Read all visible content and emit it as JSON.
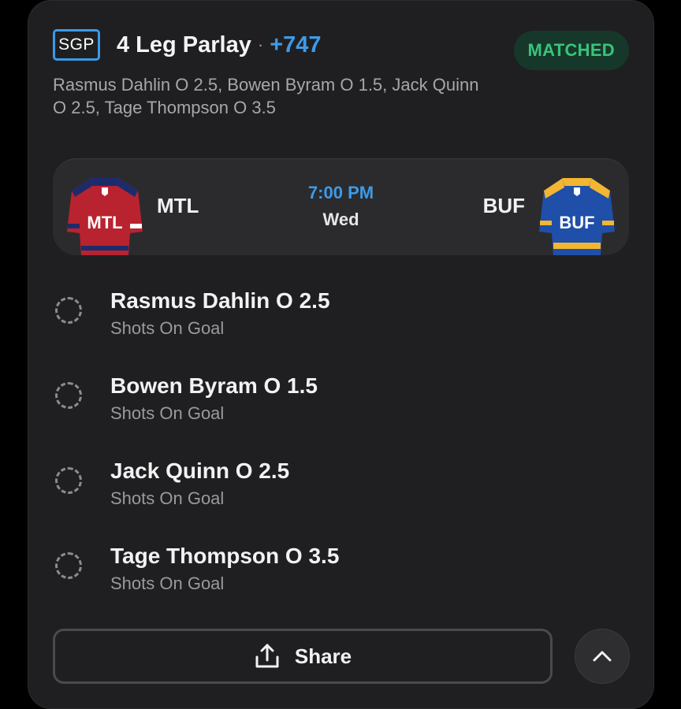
{
  "bet": {
    "badge": "SGP",
    "title": "4 Leg Parlay",
    "separator": "·",
    "odds": "+747",
    "status": "MATCHED",
    "summary": "Rasmus Dahlin O 2.5, Bowen Byram O 1.5, Jack Quinn O 2.5, Tage Thompson O 3.5"
  },
  "game": {
    "home": {
      "abbr": "MTL",
      "jersey_text": "MTL",
      "jersey_icon": "canadiens-jersey",
      "primary": "#b8232f",
      "secondary": "#1e2b6b"
    },
    "away": {
      "abbr": "BUF",
      "jersey_text": "BUF",
      "jersey_icon": "sabres-jersey",
      "primary": "#1f4fa8",
      "secondary": "#f2b632"
    },
    "time": "7:00 PM",
    "day": "Wed"
  },
  "legs": [
    {
      "title": "Rasmus Dahlin O 2.5",
      "market": "Shots On Goal",
      "status_icon": "pending-circle-icon"
    },
    {
      "title": "Bowen Byram O 1.5",
      "market": "Shots On Goal",
      "status_icon": "pending-circle-icon"
    },
    {
      "title": "Jack Quinn O 2.5",
      "market": "Shots On Goal",
      "status_icon": "pending-circle-icon"
    },
    {
      "title": "Tage Thompson O 3.5",
      "market": "Shots On Goal",
      "status_icon": "pending-circle-icon"
    }
  ],
  "actions": {
    "share_label": "Share",
    "share_icon": "share-icon",
    "collapse_icon": "chevron-up-icon"
  },
  "colors": {
    "accent": "#3d9be9",
    "matched_text": "#39c47b",
    "matched_bg": "#16382a",
    "card_bg": "#1f1f21"
  }
}
